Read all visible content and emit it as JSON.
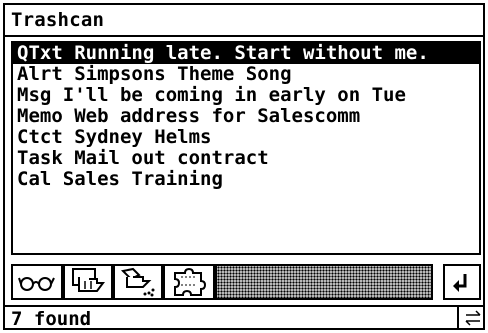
{
  "window": {
    "title": "Trashcan"
  },
  "list": {
    "items": [
      {
        "text": "QTxt Running late. Start without me.",
        "selected": true
      },
      {
        "text": "Alrt Simpsons Theme Song",
        "selected": false
      },
      {
        "text": "Msg  I'll be coming in early on Tue",
        "selected": false
      },
      {
        "text": "Memo Web address for Salescomm",
        "selected": false
      },
      {
        "text": "Ctct Sydney Helms",
        "selected": false
      },
      {
        "text": "Task Mail out contract",
        "selected": false
      },
      {
        "text": "Cal  Sales Training",
        "selected": false
      }
    ]
  },
  "toolbar": {
    "icons": [
      "glasses-icon",
      "restore-hand-icon",
      "delete-hand-icon",
      "puzzle-icon"
    ],
    "back_icon": "return-arrow-icon"
  },
  "status": {
    "text": "7 found",
    "icon": "scroll-arrows-icon"
  }
}
